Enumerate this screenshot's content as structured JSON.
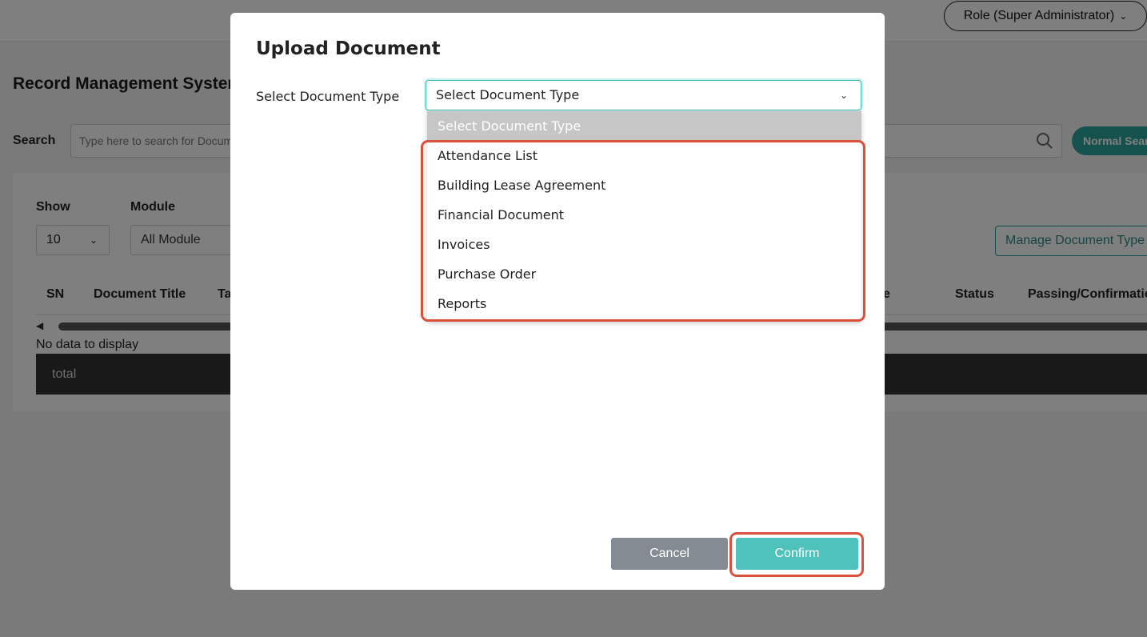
{
  "header": {
    "role_label": "Role (Super Administrator)"
  },
  "page": {
    "title": "Record Management System",
    "search_label": "Search",
    "search_placeholder": "Type here to search for Documents",
    "search_button": "Normal Search"
  },
  "filters": {
    "show_label": "Show",
    "show_value": "10",
    "module_label": "Module",
    "module_value": "All Module",
    "manage_button": "Manage Document Type"
  },
  "table": {
    "columns": [
      "SN",
      "Document Title",
      "Ta",
      "e",
      "Status",
      "Passing/Confirmation"
    ],
    "empty_text": "No data to display",
    "total_label": "total"
  },
  "modal": {
    "title": "Upload Document",
    "field_label": "Select Document Type",
    "select_value": "Select Document Type",
    "options": [
      "Select Document Type",
      "Attendance List",
      "Building Lease Agreement",
      "Financial Document",
      "Invoices",
      "Purchase Order",
      "Reports"
    ],
    "cancel_label": "Cancel",
    "confirm_label": "Confirm"
  },
  "colors": {
    "accent": "#4ec2bb",
    "highlight": "#d9503c",
    "cancel": "#858b93"
  }
}
